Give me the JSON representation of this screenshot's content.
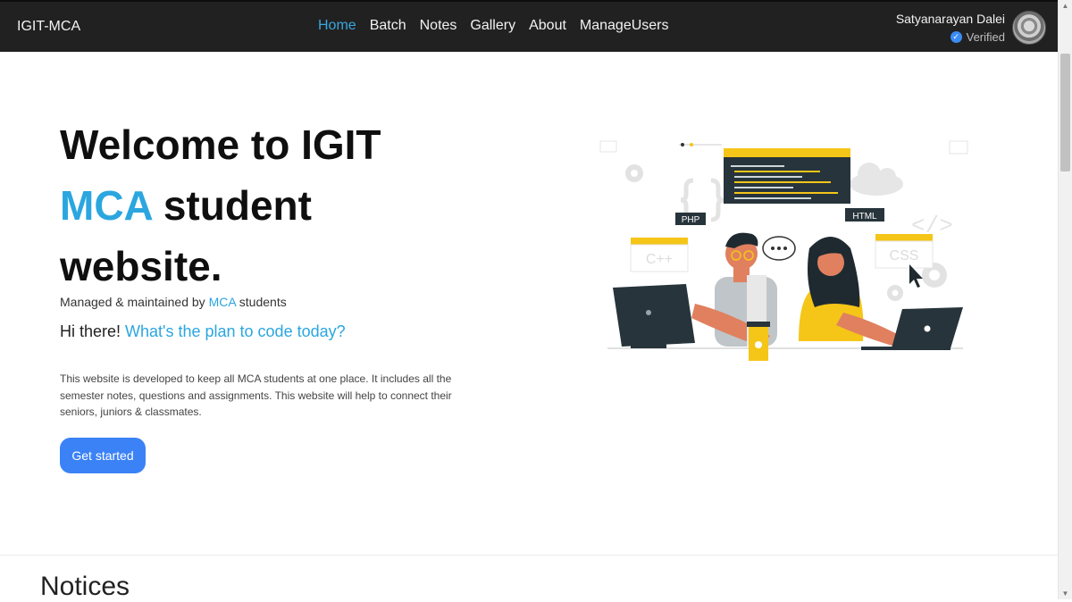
{
  "navbar": {
    "brand": "IGIT-MCA",
    "links": [
      {
        "label": "Home",
        "active": true
      },
      {
        "label": "Batch"
      },
      {
        "label": "Notes"
      },
      {
        "label": "Gallery"
      },
      {
        "label": "About"
      },
      {
        "label": "ManageUsers"
      }
    ],
    "user": {
      "name": "Satyanarayan Dalei",
      "status": "Verified"
    }
  },
  "hero": {
    "title_line1": "Welcome to IGIT",
    "title_accent": "MCA",
    "title_line2_rest": " student",
    "title_line3": "website.",
    "managed_prefix": "Managed & maintained by ",
    "managed_accent": "MCA",
    "managed_suffix": " students",
    "greeting_prefix": "Hi there! ",
    "greeting_accent": "What's the plan to code today?",
    "description": "This website is developed to keep all MCA students at one place. It includes all the semester notes, questions and assignments. This website will help to connect their seniors, juniors & classmates.",
    "cta_label": "Get started"
  },
  "illustration": {
    "tags": {
      "php": "PHP",
      "html": "HTML",
      "cpp": "C++",
      "css": "CSS",
      "code": "</>"
    }
  },
  "section": {
    "title": "Notices"
  },
  "colors": {
    "navbar_bg": "#212121",
    "accent": "#2ba6df",
    "button": "#3b82f6",
    "active_link": "#3aa7e0"
  }
}
